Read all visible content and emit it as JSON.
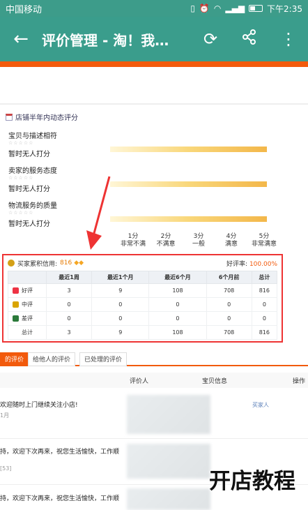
{
  "status": {
    "carrier": "中国移动",
    "time": "下午2:35",
    "icons": [
      "wechat-icon",
      "vibrate-icon",
      "alarm-icon",
      "hd-icon",
      "wifi-icon",
      "signal-icon",
      "battery-icon"
    ]
  },
  "appbar": {
    "title": "评价管理 - 淘！我…",
    "icons": [
      "back-arrow-icon",
      "refresh-icon",
      "share-icon",
      "more-vert-icon"
    ]
  },
  "colors": {
    "accent": "#3a9d8c",
    "orange": "#f25a0c",
    "alert": "#e33333"
  },
  "section": {
    "title": "店铺半年内动态评分",
    "criteria": [
      {
        "label": "宝贝与描述相符",
        "value": "暂时无人打分"
      },
      {
        "label": "卖家的服务态度",
        "value": "暂时无人打分"
      },
      {
        "label": "物流服务的质量",
        "value": "暂时无人打分"
      }
    ],
    "scale": [
      {
        "score": "1分",
        "desc": "非常不满"
      },
      {
        "score": "2分",
        "desc": "不满意"
      },
      {
        "score": "3分",
        "desc": "一般"
      },
      {
        "score": "4分",
        "desc": "满意"
      },
      {
        "score": "5分",
        "desc": "非常满意"
      }
    ]
  },
  "credit": {
    "label": "买家累积信用:",
    "score": "816",
    "rate_label": "好评率:",
    "rate_value": "100.00%",
    "columns": [
      "",
      "最近1周",
      "最近1个月",
      "最近6个月",
      "6个月前",
      "总计"
    ],
    "rows": [
      {
        "name": "好评",
        "values": [
          "3",
          "9",
          "108",
          "708",
          "816"
        ]
      },
      {
        "name": "中评",
        "values": [
          "0",
          "0",
          "0",
          "0",
          "0"
        ]
      },
      {
        "name": "差评",
        "values": [
          "0",
          "0",
          "0",
          "0",
          "0"
        ]
      },
      {
        "name": "总计",
        "values": [
          "3",
          "9",
          "108",
          "708",
          "816"
        ]
      }
    ]
  },
  "tabs": [
    "的评价",
    "给他人的评价",
    "已处理的评价"
  ],
  "list": {
    "headers": [
      "评价人",
      "宝贝信息",
      "操作"
    ],
    "buyer": "买家人",
    "items": [
      {
        "text": "欢迎随时上门继续关注小店!",
        "meta": "1月"
      },
      {
        "text": "持，欢迎下次再来，祝您生活愉快，工作顺",
        "meta": "[53]"
      },
      {
        "text": "持，欢迎下次再来，祝您生活愉快，工作顺",
        "meta": ""
      }
    ]
  },
  "watermark": "开店教程"
}
